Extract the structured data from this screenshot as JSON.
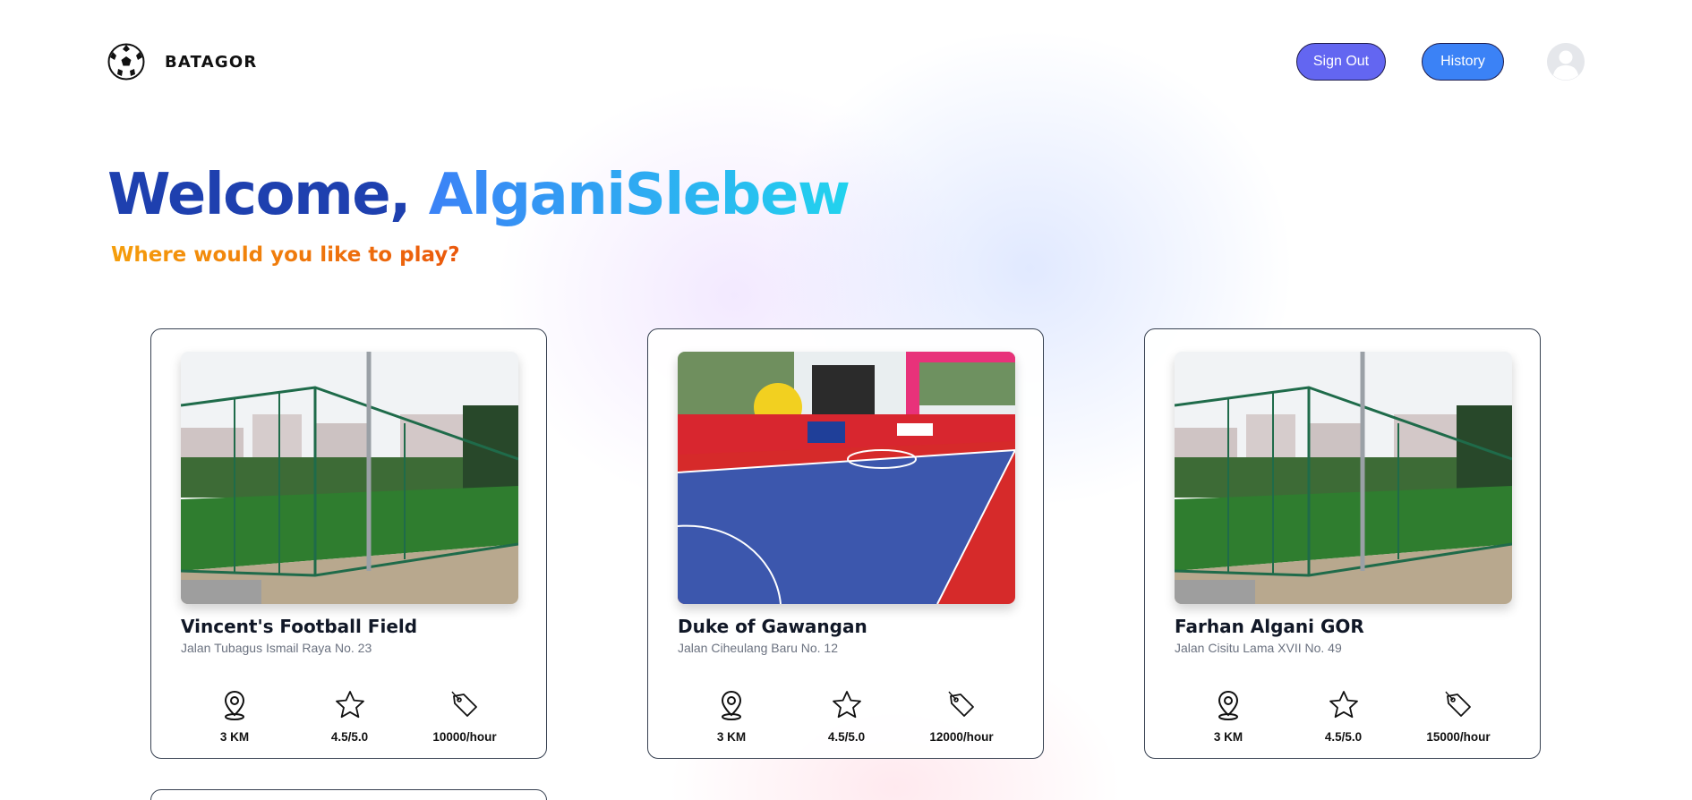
{
  "brand": {
    "name": "BATAGOR",
    "logo_icon": "soccer-ball-icon"
  },
  "nav": {
    "sign_out": "Sign Out",
    "history": "History",
    "avatar_icon": "user-avatar-icon"
  },
  "hero": {
    "greeting": "Welcome, ",
    "username": "AlganiSlebew",
    "subtitle": "Where would you like to play?"
  },
  "colors": {
    "primary": "#6366f1",
    "history": "#3b82f6",
    "title": "#1e40af",
    "username_gradient": [
      "#3b82f6",
      "#22d3ee"
    ],
    "subtitle_gradient": [
      "#f59e0b",
      "#ea580c"
    ]
  },
  "stat_icons": [
    "map-pin-icon",
    "star-icon",
    "price-tag-icon"
  ],
  "fields": [
    {
      "name": "Vincent's Football Field",
      "address": "Jalan Tubagus Ismail Raya No. 23",
      "distance": "3 KM",
      "rating": "4.5/5.0",
      "price": "10000/hour",
      "photo": "outdoor-turf-field-photo"
    },
    {
      "name": "Duke of Gawangan",
      "address": "Jalan Ciheulang Baru No. 12",
      "distance": "3 KM",
      "rating": "4.5/5.0",
      "price": "12000/hour",
      "photo": "futsal-court-photo"
    },
    {
      "name": "Farhan Algani GOR",
      "address": "Jalan Cisitu Lama XVII No. 49",
      "distance": "3 KM",
      "rating": "4.5/5.0",
      "price": "15000/hour",
      "photo": "outdoor-turf-field-photo"
    }
  ]
}
